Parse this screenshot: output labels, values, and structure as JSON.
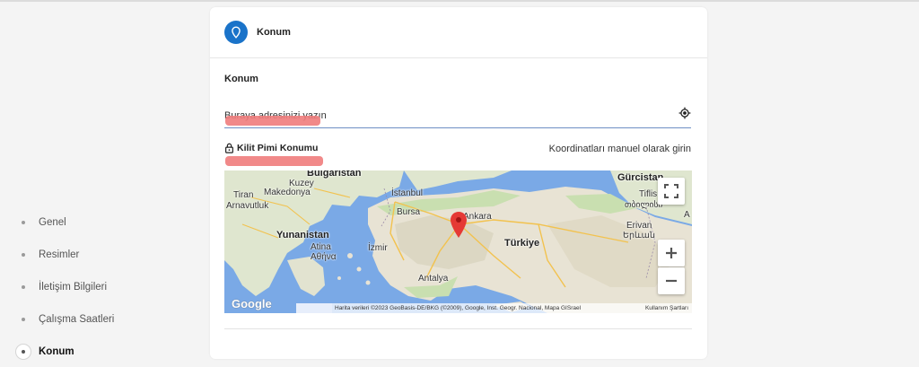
{
  "sidebar": {
    "items": [
      {
        "label": "Genel",
        "active": false
      },
      {
        "label": "Resimler",
        "active": false
      },
      {
        "label": "İletişim Bilgileri",
        "active": false
      },
      {
        "label": "Çalışma Saatleri",
        "active": false
      },
      {
        "label": "Konum",
        "active": true
      }
    ]
  },
  "card": {
    "title": "Konum",
    "section_label": "Konum",
    "address_placeholder": "Buraya adresinizi yazın",
    "lock_label": "Kilit Pimi Konumu",
    "manual_link": "Koordinatları manuel olarak girin"
  },
  "map": {
    "labels": {
      "bulgaristan": "Bulgaristan",
      "kuzey": "Kuzey",
      "makedonya": "Makedonya",
      "tiran": "Tiran",
      "arnavutluk": "Arnavutluk",
      "istanbul": "İstanbul",
      "bursa": "Bursa",
      "ankara": "Ankara",
      "yunanistan": "Yunanistan",
      "atina": "Atina",
      "atina_gr": "Αθήνα",
      "izmir": "İzmir",
      "turkiye": "Türkiye",
      "antalya": "Antalya",
      "gurcistan": "Gürcistan",
      "tiflis": "Tiflis",
      "tiflis_ka": "თბილისი",
      "erivan": "Erivan",
      "erivan_hy": "Երևան",
      "edge_a": "A"
    },
    "google": "Google",
    "attribution": "Harita verileri ©2023 GeoBasis-DE/BKG (©2009), Google, Inst. Geogr. Nacional, Mapa GISrael",
    "terms": "Kullanım Şartları",
    "colors": {
      "sea": "#7aa9e6",
      "land": "#e8e3d4",
      "green": "#c9dfb0",
      "marker": "#e53935",
      "accent": "#1a73c9"
    }
  }
}
